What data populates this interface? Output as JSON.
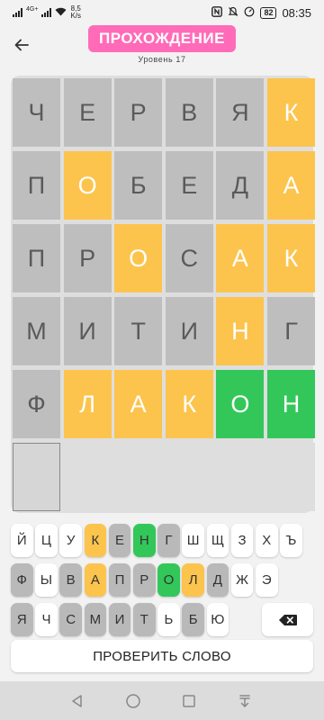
{
  "status_bar": {
    "net_tag": "4G+",
    "net_speed_value": "8,5",
    "net_speed_unit": "K/s",
    "battery": "82",
    "time": "08:35"
  },
  "header": {
    "title": "ПРОХОЖДЕНИЕ",
    "level": "Уровень 17"
  },
  "board": {
    "rows": [
      [
        {
          "l": "Ч",
          "s": "gray"
        },
        {
          "l": "Е",
          "s": "gray"
        },
        {
          "l": "Р",
          "s": "gray"
        },
        {
          "l": "В",
          "s": "gray"
        },
        {
          "l": "Я",
          "s": "gray"
        },
        {
          "l": "К",
          "s": "yellow"
        }
      ],
      [
        {
          "l": "П",
          "s": "gray"
        },
        {
          "l": "О",
          "s": "yellow"
        },
        {
          "l": "Б",
          "s": "gray"
        },
        {
          "l": "Е",
          "s": "gray"
        },
        {
          "l": "Д",
          "s": "gray"
        },
        {
          "l": "А",
          "s": "yellow"
        }
      ],
      [
        {
          "l": "П",
          "s": "gray"
        },
        {
          "l": "Р",
          "s": "gray"
        },
        {
          "l": "О",
          "s": "yellow"
        },
        {
          "l": "С",
          "s": "gray"
        },
        {
          "l": "А",
          "s": "yellow"
        },
        {
          "l": "К",
          "s": "yellow"
        }
      ],
      [
        {
          "l": "М",
          "s": "gray"
        },
        {
          "l": "И",
          "s": "gray"
        },
        {
          "l": "Т",
          "s": "gray"
        },
        {
          "l": "И",
          "s": "gray"
        },
        {
          "l": "Н",
          "s": "yellow"
        },
        {
          "l": "Г",
          "s": "gray"
        }
      ],
      [
        {
          "l": "Ф",
          "s": "gray"
        },
        {
          "l": "Л",
          "s": "yellow"
        },
        {
          "l": "А",
          "s": "yellow"
        },
        {
          "l": "К",
          "s": "yellow"
        },
        {
          "l": "О",
          "s": "green"
        },
        {
          "l": "Н",
          "s": "green"
        }
      ],
      [
        {
          "l": "",
          "s": "active"
        },
        {
          "l": "",
          "s": "empty"
        },
        {
          "l": "",
          "s": "empty"
        },
        {
          "l": "",
          "s": "empty"
        },
        {
          "l": "",
          "s": "empty"
        },
        {
          "l": "",
          "s": "empty"
        }
      ]
    ]
  },
  "keyboard": {
    "row1": [
      {
        "l": "Й",
        "s": "white"
      },
      {
        "l": "Ц",
        "s": "white"
      },
      {
        "l": "У",
        "s": "white"
      },
      {
        "l": "К",
        "s": "yellow"
      },
      {
        "l": "Е",
        "s": "gray"
      },
      {
        "l": "Н",
        "s": "green"
      },
      {
        "l": "Г",
        "s": "gray"
      },
      {
        "l": "Ш",
        "s": "white"
      },
      {
        "l": "Щ",
        "s": "white"
      },
      {
        "l": "З",
        "s": "white"
      },
      {
        "l": "Х",
        "s": "white"
      },
      {
        "l": "Ъ",
        "s": "white"
      }
    ],
    "row2": [
      {
        "l": "Ф",
        "s": "gray"
      },
      {
        "l": "Ы",
        "s": "white"
      },
      {
        "l": "В",
        "s": "gray"
      },
      {
        "l": "А",
        "s": "yellow"
      },
      {
        "l": "П",
        "s": "gray"
      },
      {
        "l": "Р",
        "s": "gray"
      },
      {
        "l": "О",
        "s": "green"
      },
      {
        "l": "Л",
        "s": "yellow"
      },
      {
        "l": "Д",
        "s": "gray"
      },
      {
        "l": "Ж",
        "s": "white"
      },
      {
        "l": "Э",
        "s": "white"
      }
    ],
    "row3": [
      {
        "l": "Я",
        "s": "gray"
      },
      {
        "l": "Ч",
        "s": "white"
      },
      {
        "l": "С",
        "s": "gray"
      },
      {
        "l": "М",
        "s": "gray"
      },
      {
        "l": "И",
        "s": "gray"
      },
      {
        "l": "Т",
        "s": "gray"
      },
      {
        "l": "Ь",
        "s": "white"
      },
      {
        "l": "Б",
        "s": "gray"
      },
      {
        "l": "Ю",
        "s": "white"
      }
    ],
    "backspace_icon": "backspace-icon"
  },
  "actions": {
    "check_word": "ПРОВЕРИТЬ СЛОВО"
  },
  "icons": {
    "back": "arrow-left-icon",
    "nav_back": "triangle-back-icon",
    "nav_home": "circle-home-icon",
    "nav_recent": "square-recent-icon",
    "nav_extra": "download-icon"
  },
  "colors": {
    "accent_pink": "#ff6bb8",
    "tile_gray": "#bebebe",
    "tile_yellow": "#fcc44d",
    "tile_green": "#33c75a"
  }
}
